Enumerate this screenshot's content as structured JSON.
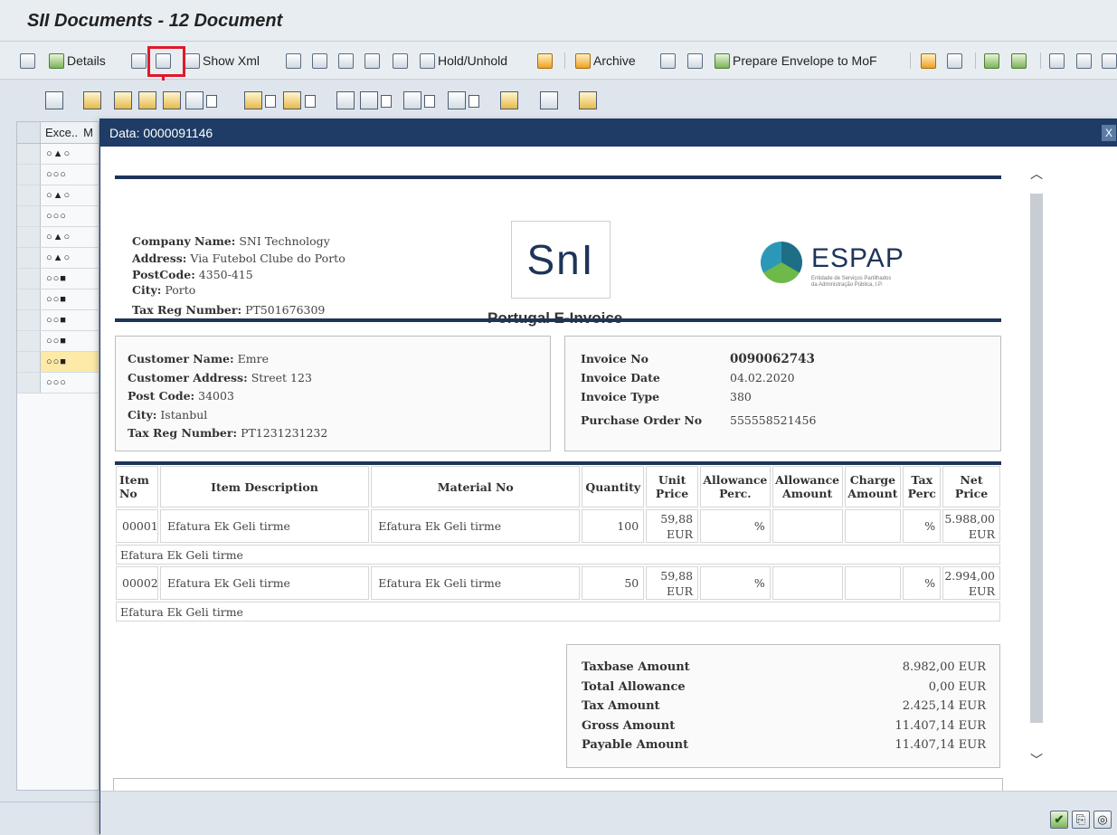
{
  "window": {
    "title": "SII Documents - 12 Document"
  },
  "toolbar": {
    "details_label": "Details",
    "show_xml_label": "Show Xml",
    "hold_label": "Hold/Unhold",
    "archive_label": "Archive",
    "prepare_label": "Prepare Envelope to MoF"
  },
  "grid": {
    "col_excel": "Exce..",
    "col_m": "M",
    "rows": [
      "○▲○",
      "○○○",
      "○▲○",
      "○○○",
      "○▲○",
      "○▲○",
      "○○■",
      "○○■",
      "○○■",
      "○○■",
      "○○■",
      "○○○"
    ]
  },
  "popup": {
    "title": "Data: 0000091146",
    "close": "X"
  },
  "invoice": {
    "company": {
      "name_label": "Company Name:",
      "name": "SNI Technology",
      "address_label": "Address:",
      "address": "Via Futebol Clube do Porto",
      "postcode_label": "PostCode:",
      "postcode": "4350-415",
      "city_label": "City:",
      "city": "Porto",
      "tax_label": "Tax Reg Number:",
      "tax": "PT501676309"
    },
    "logo_text": "SnI",
    "espap_logo": "ESPAP",
    "espap_sub1": "Entidade de Serviços Partilhados",
    "espap_sub2": "da Administração Pública, I.P.",
    "title": "Portugal E-Invoice",
    "customer": {
      "name_label": "Customer Name:",
      "name": "Emre",
      "address_label": "Customer Address:",
      "address": "Street 123",
      "postcode_label": "Post Code:",
      "postcode": "34003",
      "city_label": "City:",
      "city": "Istanbul",
      "tax_label": "Tax Reg Number:",
      "tax": "PT1231231232"
    },
    "info": {
      "no_label": "Invoice No",
      "no": "0090062743",
      "date_label": "Invoice Date",
      "date": "04.02.2020",
      "type_label": "Invoice Type",
      "type": "380",
      "po_label": "Purchase Order No",
      "po": "555558521456"
    },
    "items_header": {
      "item_no": "Item No",
      "desc": "Item Description",
      "material": "Material No",
      "qty": "Quantity",
      "unit_price": "Unit Price",
      "allow_perc": "Allowance Perc.",
      "allow_amt": "Allowance Amount",
      "charge_amt": "Charge Amount",
      "tax_perc": "Tax Perc",
      "net_price": "Net Price"
    },
    "items": [
      {
        "no": "00001",
        "desc": "Efatura Ek Geli tirme",
        "material": "Efatura Ek Geli tirme",
        "qty": "100",
        "unit_price": "59,88",
        "unit_cur": "EUR",
        "allow_perc": "%",
        "allow_amt": "",
        "charge_amt": "",
        "tax_perc": "%",
        "net_price": "5.988,00",
        "net_cur": "EUR",
        "note": "Efatura Ek Geli tirme"
      },
      {
        "no": "00002",
        "desc": "Efatura Ek Geli tirme",
        "material": "Efatura Ek Geli tirme",
        "qty": "50",
        "unit_price": "59,88",
        "unit_cur": "EUR",
        "allow_perc": "%",
        "allow_amt": "",
        "charge_amt": "",
        "tax_perc": "%",
        "net_price": "2.994,00",
        "net_cur": "EUR",
        "note": "Efatura Ek Geli tirme"
      }
    ],
    "totals": [
      {
        "label": "Taxbase Amount",
        "value": "8.982,00 EUR"
      },
      {
        "label": "Total Allowance",
        "value": "0,00 EUR"
      },
      {
        "label": "Tax Amount",
        "value": "2.425,14 EUR"
      },
      {
        "label": "Gross Amount",
        "value": "11.407,14 EUR"
      },
      {
        "label": "Payable Amount",
        "value": "11.407,14 EUR"
      }
    ]
  },
  "footer": {
    "ok": "✔",
    "b2": "⎘",
    "b3": "◎"
  },
  "colors": {
    "highlight": "#e0192b",
    "popup_header": "#1e3c66",
    "doc_rule": "#1e3459"
  }
}
